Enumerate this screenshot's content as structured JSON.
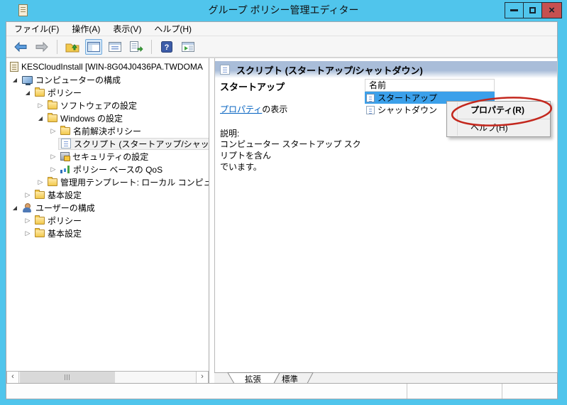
{
  "window": {
    "title": "グループ ポリシー管理エディター"
  },
  "glyphs": {
    "tree_collapsed": "▷",
    "tree_expanded": "◢",
    "scroll_left": "‹",
    "scroll_right": "›",
    "close": "×"
  },
  "menu_bar": {
    "items": [
      {
        "label": "ファイル(F)"
      },
      {
        "label": "操作(A)"
      },
      {
        "label": "表示(V)"
      },
      {
        "label": "ヘルプ(H)"
      }
    ]
  },
  "toolbar": {
    "icons": [
      "back-arrow",
      "forward-arrow",
      "up-one-level",
      "show-console-tree",
      "properties",
      "export-list",
      "help",
      "show-action-pane"
    ]
  },
  "tree": {
    "items": [
      {
        "label": "KESCloudInstall [WIN-8G04J0436PA.TWDOMA",
        "level": 0,
        "icon": "gpo-scroll",
        "state": "root",
        "selected": false
      },
      {
        "label": "コンピューターの構成",
        "level": 1,
        "icon": "computer",
        "state": "expanded",
        "selected": false
      },
      {
        "label": "ポリシー",
        "level": 2,
        "icon": "folder",
        "state": "expanded",
        "selected": false
      },
      {
        "label": "ソフトウェアの設定",
        "level": 3,
        "icon": "folder",
        "state": "collapsed",
        "selected": false
      },
      {
        "label": "Windows の設定",
        "level": 3,
        "icon": "folder",
        "state": "expanded",
        "selected": false
      },
      {
        "label": "名前解決ポリシー",
        "level": 4,
        "icon": "folder",
        "state": "collapsed",
        "selected": false
      },
      {
        "label": "スクリプト (スタートアップ/シャットダウン)",
        "level": 4,
        "icon": "script",
        "state": "leaf",
        "selected": true
      },
      {
        "label": "セキュリティの設定",
        "level": 4,
        "icon": "security",
        "state": "collapsed",
        "selected": false
      },
      {
        "label": "ポリシー ベースの QoS",
        "level": 4,
        "icon": "qos",
        "state": "collapsed",
        "selected": false
      },
      {
        "label": "管理用テンプレート: ローカル コンピューターか",
        "level": 3,
        "icon": "folder",
        "state": "collapsed",
        "selected": false
      },
      {
        "label": "基本設定",
        "level": 2,
        "icon": "folder",
        "state": "collapsed",
        "selected": false
      },
      {
        "label": "ユーザーの構成",
        "level": 1,
        "icon": "users",
        "state": "expanded",
        "selected": false
      },
      {
        "label": "ポリシー",
        "level": 2,
        "icon": "folder",
        "state": "collapsed",
        "selected": false
      },
      {
        "label": "基本設定",
        "level": 2,
        "icon": "folder",
        "state": "collapsed",
        "selected": false
      }
    ]
  },
  "main": {
    "header": {
      "title": "スクリプト (スタートアップ/シャットダウン)",
      "icon": "script-icon"
    },
    "extended_view": {
      "selected_item": "スタートアップ",
      "link": "プロパティ",
      "link_suffix": "の表示",
      "description_label": "説明:",
      "description_line1": "コンピューター スタートアップ スクリプトを含ん",
      "description_line2": "でいます。"
    },
    "list": {
      "column": "名前",
      "items": [
        {
          "label": "スタートアップ",
          "selected": true
        },
        {
          "label": "シャットダウン",
          "selected": false
        }
      ]
    },
    "tabs": [
      {
        "label": "拡張",
        "active": true
      },
      {
        "label": "標準",
        "active": false
      }
    ]
  },
  "context_menu": {
    "items": [
      {
        "label": "プロパティ(R)",
        "bold": true,
        "annotated": true
      },
      {
        "label": "ヘルプ(H)",
        "bold": false,
        "annotated": false
      }
    ]
  },
  "annotation": {
    "type": "red-ellipse",
    "target": "プロパティ(R)",
    "color": "#C3271D"
  },
  "colors": {
    "titlebar": "#50C5EC",
    "close_button": "#C75050",
    "selection": "#3BA0EA",
    "link": "#0563C1",
    "header_gradient_top": "#A9BDD9",
    "annotation_red": "#C3271D"
  }
}
